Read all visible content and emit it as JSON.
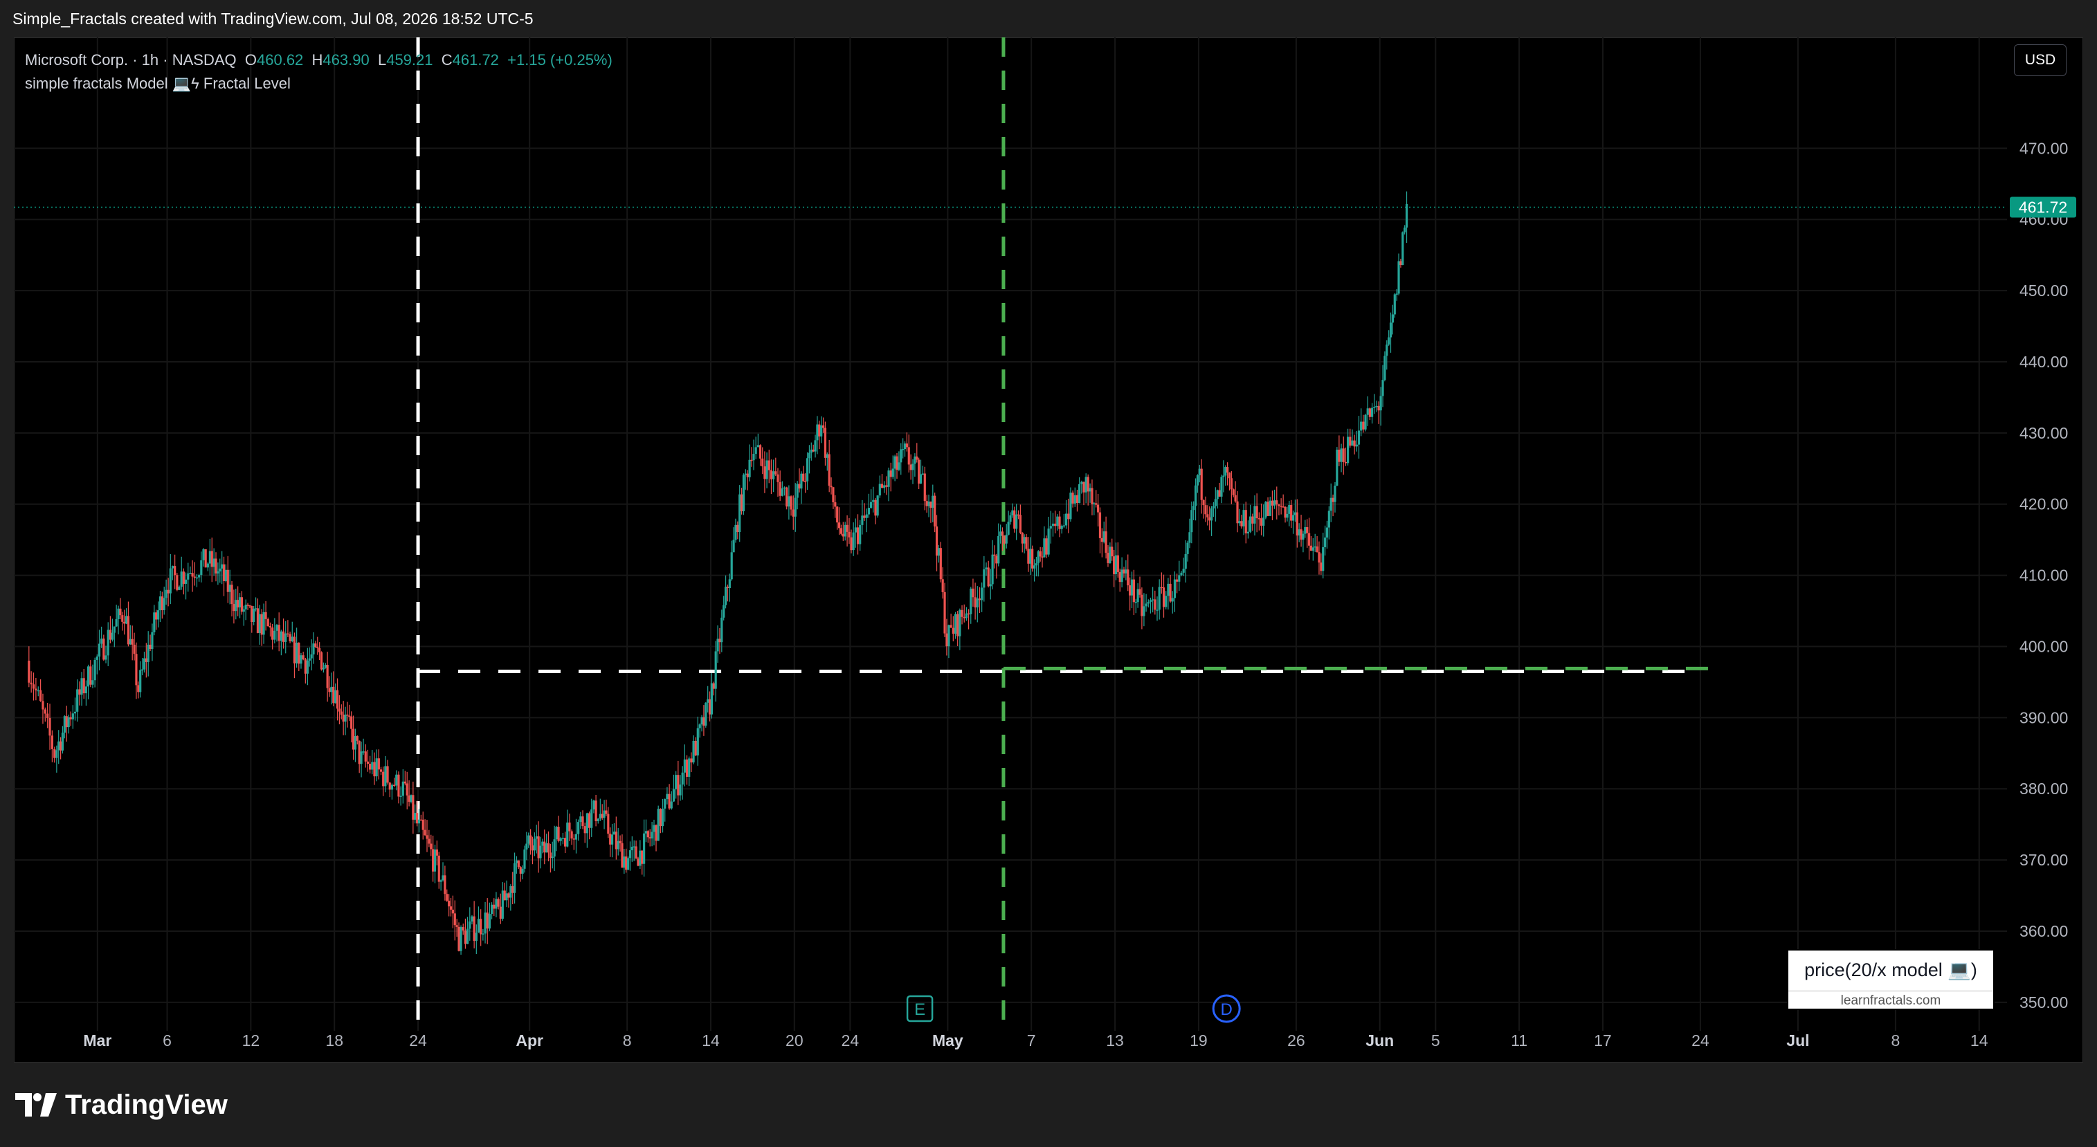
{
  "caption": "Simple_Fractals created with TradingView.com, Jul 08, 2026 18:52 UTC-5",
  "legend": {
    "symbol": "Microsoft Corp. · 1h · NASDAQ",
    "o_label": "O",
    "o_value": "460.62",
    "h_label": "H",
    "h_value": "463.90",
    "l_label": "L",
    "l_value": "459.21",
    "c_label": "C",
    "c_value": "461.72",
    "change": "+1.15 (+0.25%)",
    "indicator": "simple fractals Model 💻ϟ Fractal Level"
  },
  "currency_button": "USD",
  "info_box": {
    "title": "price(20/x model 💻)",
    "subtitle": "learnfractals.com"
  },
  "branding": {
    "logo_text": "TradingView"
  },
  "colors": {
    "background": "#000000",
    "up": "#26a69a",
    "down": "#ef5350",
    "grid": "#161616",
    "axis_text": "#b2b5be",
    "fractal_white": "#ffffff",
    "fractal_green": "#4caf50",
    "last_price": "#089981",
    "earnings_marker": "#26a69a",
    "dividend_marker": "#2962ff"
  },
  "chart_data": {
    "type": "candlestick",
    "symbol": "Microsoft Corp.",
    "timeframe": "1h",
    "exchange": "NASDAQ",
    "y_axis": {
      "currency": "USD",
      "range": [
        346,
        485
      ],
      "ticks": [
        350,
        360,
        370,
        380,
        390,
        400,
        410,
        420,
        430,
        440,
        450,
        460,
        470
      ],
      "tick_labels": [
        "350.00",
        "360.00",
        "370.00",
        "380.00",
        "390.00",
        "400.00",
        "410.00",
        "420.00",
        "430.00",
        "440.00",
        "450.00",
        "460.00",
        "470.00"
      ]
    },
    "x_axis": {
      "labels": [
        "Mar",
        "6",
        "12",
        "18",
        "24",
        "Apr",
        "8",
        "14",
        "20",
        "24",
        "May",
        "7",
        "13",
        "19",
        "26",
        "Jun",
        "5",
        "11",
        "17",
        "24",
        "Jul",
        "8",
        "14"
      ],
      "major": [
        "Mar",
        "Apr",
        "May",
        "Jun",
        "Jul"
      ],
      "label_dates": [
        "2026-03-01",
        "2026-03-06",
        "2026-03-12",
        "2026-03-18",
        "2026-03-24",
        "2026-04-01",
        "2026-04-08",
        "2026-04-14",
        "2026-04-20",
        "2026-04-24",
        "2026-05-01",
        "2026-05-07",
        "2026-05-13",
        "2026-05-19",
        "2026-05-26",
        "2026-06-01",
        "2026-06-05",
        "2026-06-11",
        "2026-06-17",
        "2026-06-24",
        "2026-07-01",
        "2026-07-08",
        "2026-07-14"
      ]
    },
    "price_path": [
      [
        "2026-02-24",
        398
      ],
      [
        "2026-02-26",
        385
      ],
      [
        "2026-02-27",
        390
      ],
      [
        "2026-03-02",
        402
      ],
      [
        "2026-03-03",
        405
      ],
      [
        "2026-03-04",
        394
      ],
      [
        "2026-03-05",
        402
      ],
      [
        "2026-03-06",
        409
      ],
      [
        "2026-03-09",
        412
      ],
      [
        "2026-03-10",
        410
      ],
      [
        "2026-03-11",
        406
      ],
      [
        "2026-03-12",
        404
      ],
      [
        "2026-03-13",
        403
      ],
      [
        "2026-03-16",
        398
      ],
      [
        "2026-03-17",
        399
      ],
      [
        "2026-03-18",
        394
      ],
      [
        "2026-03-19",
        389
      ],
      [
        "2026-03-20",
        384
      ],
      [
        "2026-03-23",
        380
      ],
      [
        "2026-03-24",
        375
      ],
      [
        "2026-03-25",
        371
      ],
      [
        "2026-03-26",
        366
      ],
      [
        "2026-03-27",
        359
      ],
      [
        "2026-03-30",
        363
      ],
      [
        "2026-03-31",
        368
      ],
      [
        "2026-04-01",
        372
      ],
      [
        "2026-04-02",
        371
      ],
      [
        "2026-04-03",
        373
      ],
      [
        "2026-04-06",
        377
      ],
      [
        "2026-04-07",
        373
      ],
      [
        "2026-04-08",
        370
      ],
      [
        "2026-04-09",
        371
      ],
      [
        "2026-04-10",
        374
      ],
      [
        "2026-04-13",
        386
      ],
      [
        "2026-04-14",
        392
      ],
      [
        "2026-04-15",
        405
      ],
      [
        "2026-04-16",
        418
      ],
      [
        "2026-04-17",
        428
      ],
      [
        "2026-04-20",
        420
      ],
      [
        "2026-04-21",
        425
      ],
      [
        "2026-04-22",
        432
      ],
      [
        "2026-04-23",
        418
      ],
      [
        "2026-04-24",
        414
      ],
      [
        "2026-04-27",
        424
      ],
      [
        "2026-04-28",
        427
      ],
      [
        "2026-04-29",
        424
      ],
      [
        "2026-04-30",
        420
      ],
      [
        "2026-05-01",
        401
      ],
      [
        "2026-05-04",
        410
      ],
      [
        "2026-05-05",
        415
      ],
      [
        "2026-05-06",
        419
      ],
      [
        "2026-05-07",
        412
      ],
      [
        "2026-05-08",
        414
      ],
      [
        "2026-05-11",
        423
      ],
      [
        "2026-05-12",
        416
      ],
      [
        "2026-05-13",
        412
      ],
      [
        "2026-05-14",
        409
      ],
      [
        "2026-05-15",
        405
      ],
      [
        "2026-05-18",
        409
      ],
      [
        "2026-05-19",
        424
      ],
      [
        "2026-05-20",
        418
      ],
      [
        "2026-05-21",
        424
      ],
      [
        "2026-05-22",
        417
      ],
      [
        "2026-05-25",
        420
      ],
      [
        "2026-05-26",
        418
      ],
      [
        "2026-05-27",
        414
      ],
      [
        "2026-05-28",
        412
      ],
      [
        "2026-05-29",
        426
      ],
      [
        "2026-06-01",
        434
      ],
      [
        "2026-06-02",
        446
      ],
      [
        "2026-06-03",
        461.72
      ]
    ],
    "last_price": 461.72,
    "last_price_label": "461.72",
    "fractal_level": {
      "white": {
        "price": 396.5,
        "from": "2026-03-24",
        "to": "2026-06-23"
      },
      "green": {
        "price": 396.9,
        "from": "2026-05-05",
        "to": "2026-06-25"
      },
      "vlines": [
        {
          "color": "white",
          "at": "2026-03-24"
        },
        {
          "color": "green",
          "at": "2026-05-05"
        }
      ]
    },
    "markers": [
      {
        "type": "earnings",
        "label": "E",
        "at": "2026-04-29"
      },
      {
        "type": "dividend",
        "label": "D",
        "at": "2026-05-21"
      }
    ]
  }
}
